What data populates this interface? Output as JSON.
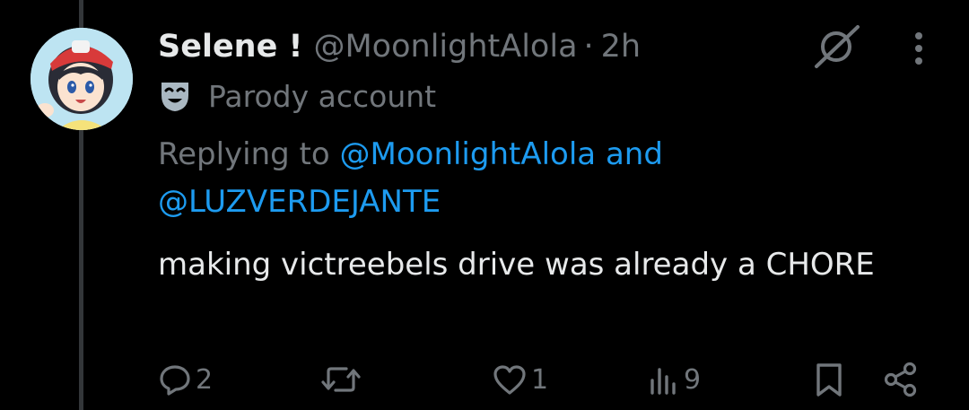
{
  "post": {
    "author": {
      "display_name": "Selene !",
      "handle": "@MoonlightAlola",
      "separator": "·",
      "time": "2h",
      "label": "Parody account"
    },
    "replying": {
      "prefix": "Replying to ",
      "mention_1": "@MoonlightAlola",
      "conjunction": " and ",
      "mention_2": "@LUZVERDEJANTE"
    },
    "text": "making victreebels drive was already a CHORE",
    "stats": {
      "replies": "2",
      "reposts": "",
      "likes": "1",
      "views": "9"
    }
  },
  "icons": {
    "grok": "grok-slash-circle-icon",
    "more": "more-vertical-icon",
    "parody": "theater-mask-icon",
    "reply": "speech-bubble-icon",
    "repost": "repost-arrows-icon",
    "like": "heart-icon",
    "views": "bar-chart-icon",
    "bookmark": "bookmark-icon",
    "share": "share-nodes-icon"
  },
  "colors": {
    "background": "#000000",
    "text_primary": "#e7e9ea",
    "text_secondary": "#71767b",
    "link": "#1d9bf0",
    "thread_line": "#333639"
  }
}
